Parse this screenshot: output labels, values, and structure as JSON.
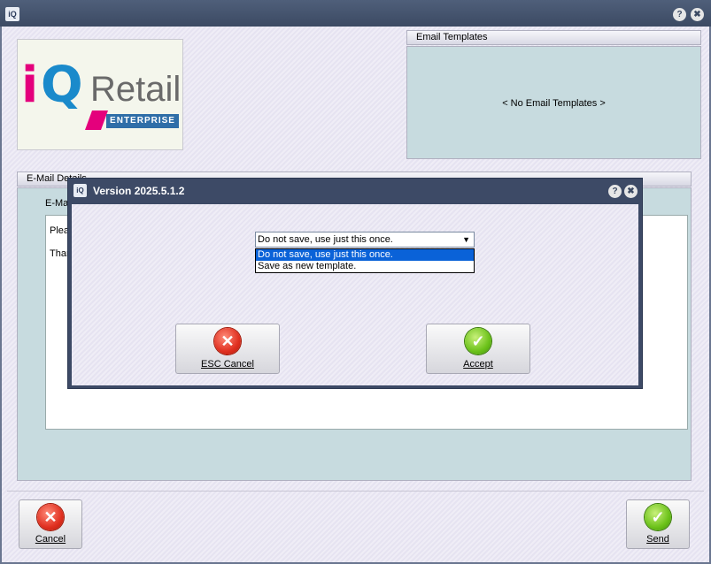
{
  "window": {
    "logo_text": "iQ",
    "help_icon": "?",
    "close_icon": "✖"
  },
  "logo": {
    "i": "i",
    "q": "Q",
    "retail": "Retail",
    "enterprise": "ENTERPRISE"
  },
  "email_templates": {
    "header": "Email Templates",
    "empty_text": "< No Email Templates >"
  },
  "email_details": {
    "header": "E-Mail Details",
    "label": "E-Ma",
    "line1": "Pleas",
    "line2": "Than"
  },
  "footer": {
    "cancel_label": "Cancel",
    "send_label": "Send"
  },
  "dialog": {
    "title": "Version 2025.5.1.2",
    "combo_value": "Do not save, use just this once.",
    "options": [
      "Do not save, use just this once.",
      "Save as new template."
    ],
    "esc_cancel_label": "ESC Cancel",
    "accept_label": "Accept"
  }
}
